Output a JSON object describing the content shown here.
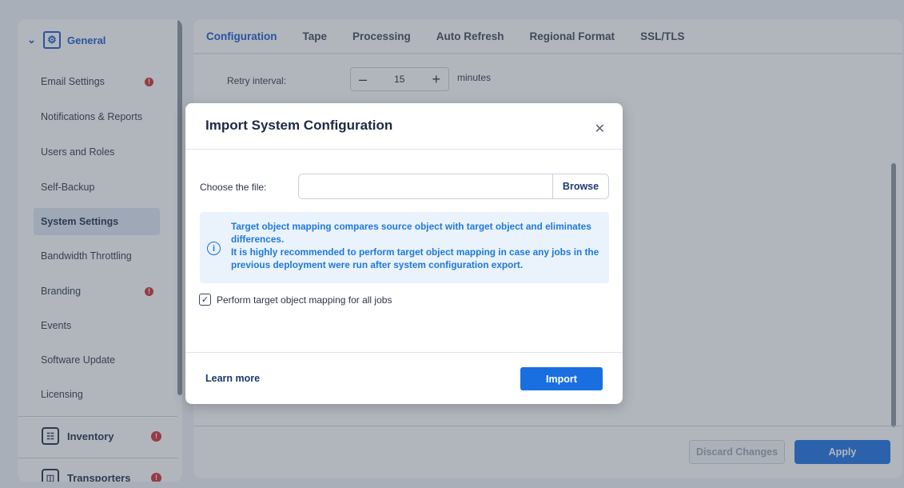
{
  "sidebar": {
    "header": {
      "label": "General"
    },
    "items": [
      {
        "label": "Email Settings",
        "warning": true
      },
      {
        "label": "Notifications & Reports",
        "warning": false
      },
      {
        "label": "Users and Roles",
        "warning": false
      },
      {
        "label": "Self-Backup",
        "warning": false
      },
      {
        "label": "System Settings",
        "warning": false,
        "active": true
      },
      {
        "label": "Bandwidth Throttling",
        "warning": false
      },
      {
        "label": "Branding",
        "warning": true
      },
      {
        "label": "Events",
        "warning": false
      },
      {
        "label": "Software Update",
        "warning": false
      },
      {
        "label": "Licensing",
        "warning": false
      }
    ],
    "sections": [
      {
        "label": "Inventory",
        "warning": true
      },
      {
        "label": "Transporters",
        "warning": true
      }
    ]
  },
  "tabs": [
    {
      "label": "Configuration",
      "active": true
    },
    {
      "label": "Tape"
    },
    {
      "label": "Processing"
    },
    {
      "label": "Auto Refresh"
    },
    {
      "label": "Regional Format"
    },
    {
      "label": "SSL/TLS"
    }
  ],
  "settings": {
    "retry_label": "Retry interval:",
    "retry_value": "15",
    "retry_unit": "minutes"
  },
  "footer": {
    "discard_label": "Discard Changes",
    "apply_label": "Apply"
  },
  "modal": {
    "title": "Import System Configuration",
    "file_label": "Choose the file:",
    "file_value": "",
    "browse_label": "Browse",
    "info_line1": "Target object mapping compares source object with target object and eliminates differences.",
    "info_line2": "It is highly recommended to perform target object mapping in case any jobs in the previous deployment were run after system configuration export.",
    "checkbox_label": "Perform target object mapping for all jobs",
    "checkbox_checked": true,
    "learn_more_label": "Learn more",
    "import_label": "Import"
  },
  "colors": {
    "accent": "#1a6fe0",
    "info_text": "#1e79d8",
    "warning": "#d12b2b"
  }
}
